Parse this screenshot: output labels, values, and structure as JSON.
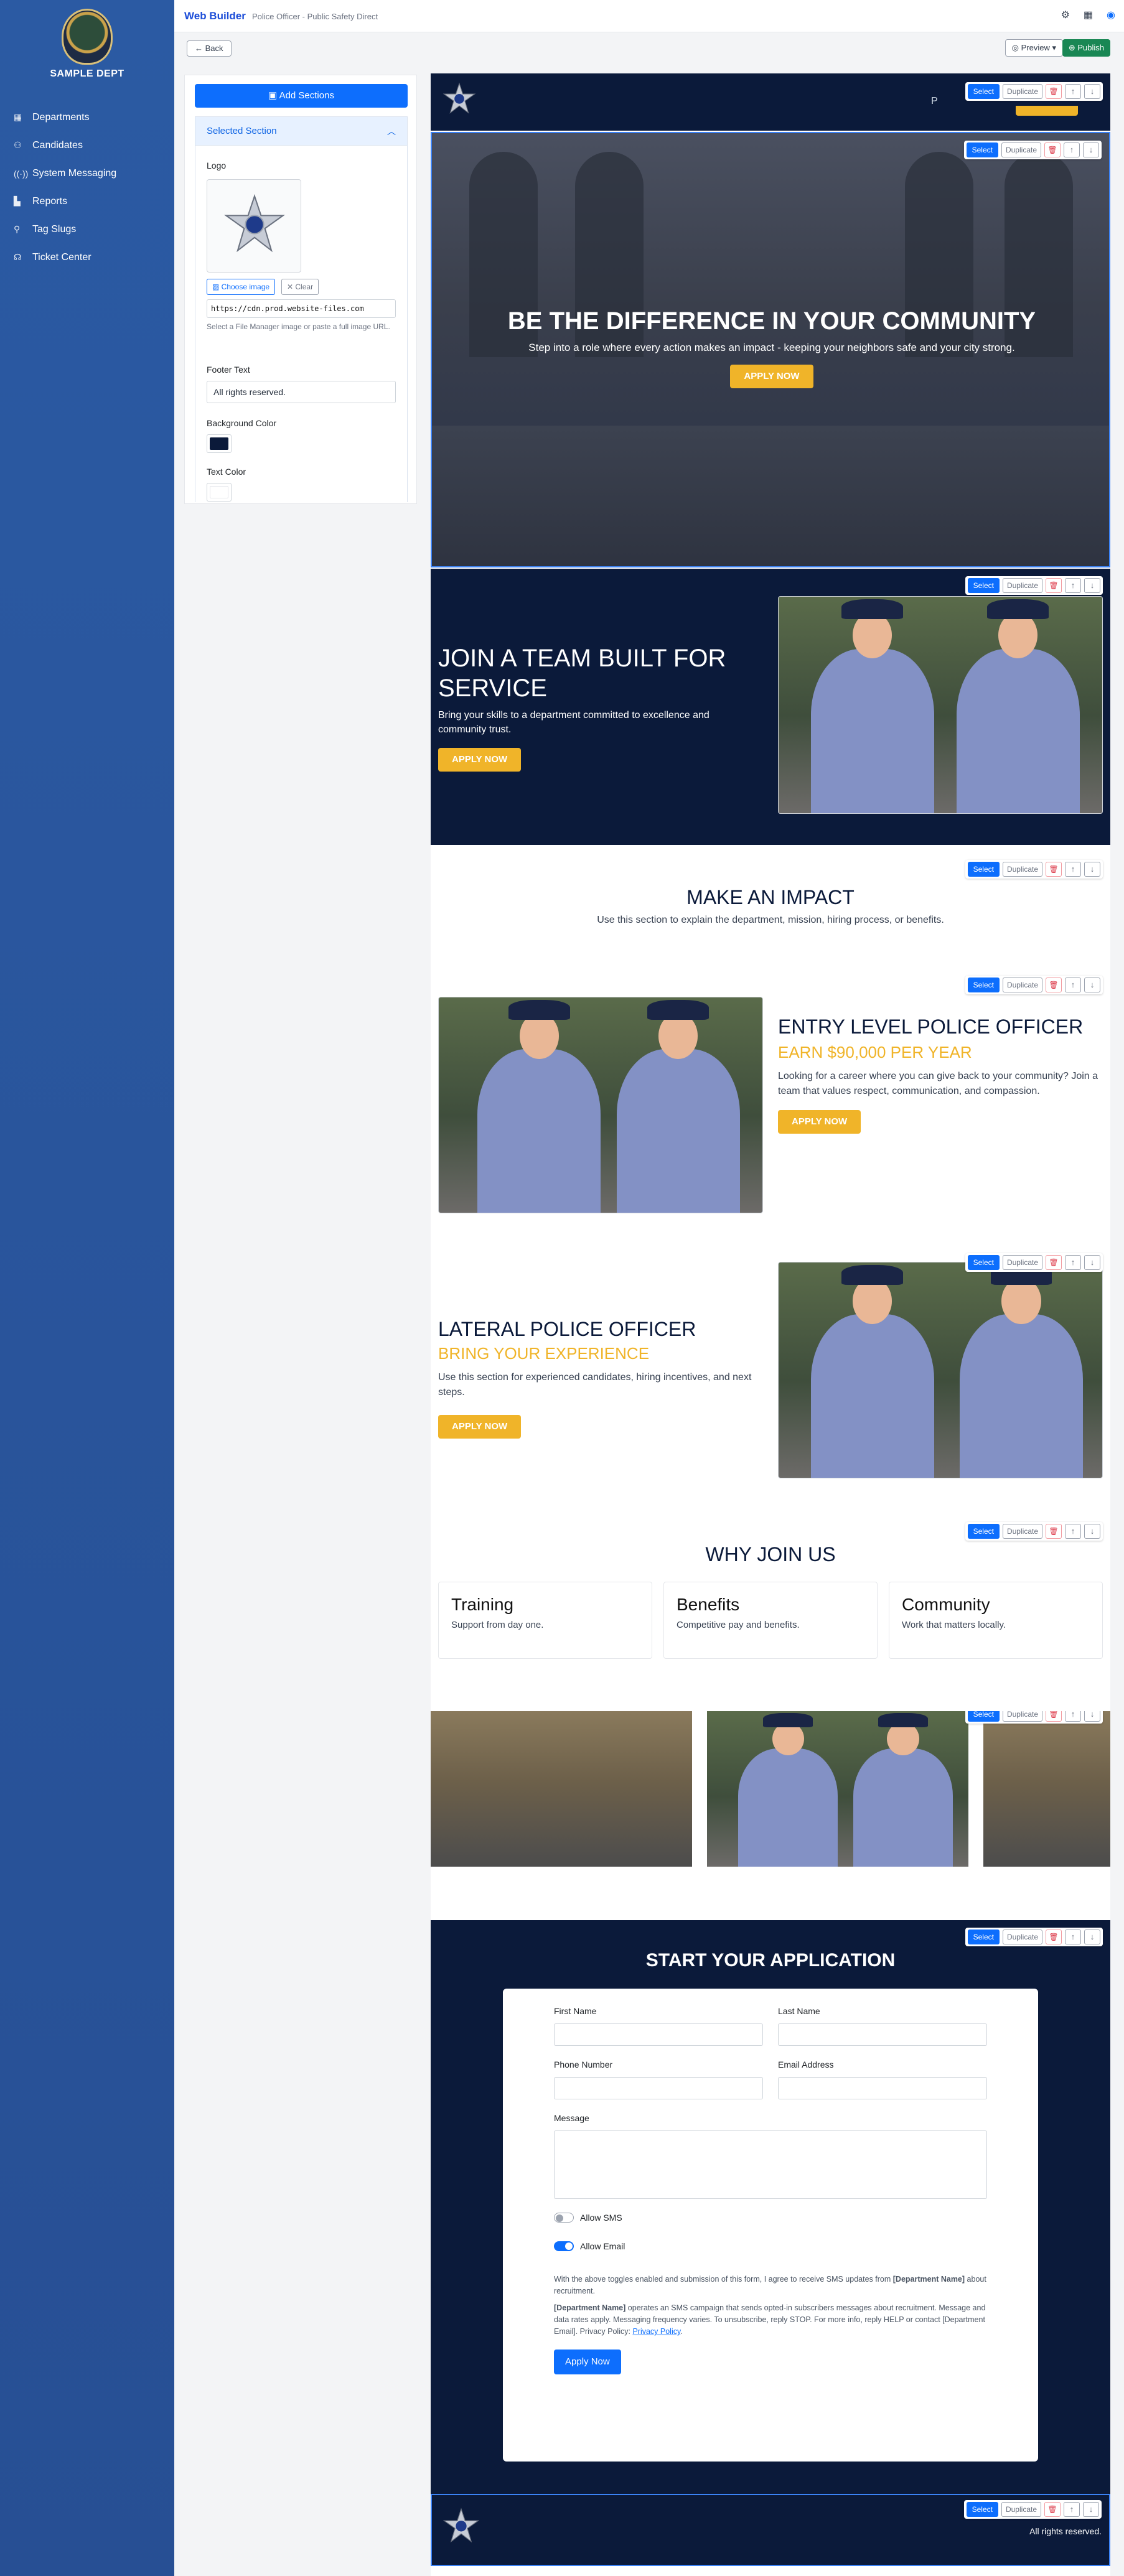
{
  "sidebar": {
    "dept_name": "SAMPLE DEPT",
    "items": [
      {
        "label": "Departments",
        "icon": "building-icon"
      },
      {
        "label": "Candidates",
        "icon": "users-icon"
      },
      {
        "label": "System Messaging",
        "icon": "broadcast-icon"
      },
      {
        "label": "Reports",
        "icon": "chart-icon"
      },
      {
        "label": "Tag Slugs",
        "icon": "tag-icon"
      },
      {
        "label": "Ticket Center",
        "icon": "headset-icon"
      }
    ]
  },
  "topbar": {
    "title": "Web Builder",
    "subtitle": "Police Officer - Public Safety Direct"
  },
  "toolbar": {
    "back_label": "Back",
    "preview_label": "Preview",
    "publish_label": "Publish"
  },
  "panel": {
    "add_sections_label": "Add Sections",
    "section_title": "Selected Section",
    "logo_label": "Logo",
    "choose_image_label": "Choose image",
    "clear_label": "Clear",
    "logo_url": "https://cdn.prod.website-files.com",
    "logo_help": "Select a File Manager image or paste a full image URL.",
    "footer_text_label": "Footer Text",
    "footer_text_value": "All rights reserved.",
    "bg_color_label": "Background Color",
    "bg_color": "#0b1a3a",
    "text_color_label": "Text Color",
    "text_color": "#ffffff"
  },
  "controls": {
    "select": "Select",
    "duplicate": "Duplicate"
  },
  "hero": {
    "title": "BE THE DIFFERENCE IN YOUR COMMUNITY",
    "subtitle": "Step into a role where every action makes an impact - keeping your neighbors safe and your city strong.",
    "cta": "APPLY NOW"
  },
  "team": {
    "title": "JOIN A TEAM BUILT FOR SERVICE",
    "text": "Bring your skills to a department committed to excellence and community trust.",
    "cta": "APPLY NOW"
  },
  "impact": {
    "title": "MAKE AN IMPACT",
    "text": "Use this section to explain the department, mission, hiring process, or benefits."
  },
  "entry": {
    "title": "ENTRY LEVEL POLICE OFFICER",
    "highlight": "EARN $90,000 PER YEAR",
    "text": "Looking for a career where you can give back to your community? Join a team that values respect, communication, and compassion.",
    "cta": "APPLY NOW"
  },
  "lateral": {
    "title": "LATERAL POLICE OFFICER",
    "highlight": "BRING YOUR EXPERIENCE",
    "text": "Use this section for experienced candidates, hiring incentives, and next steps.",
    "cta": "APPLY NOW"
  },
  "why": {
    "title": "WHY JOIN US",
    "cards": [
      {
        "title": "Training",
        "text": "Support from day one."
      },
      {
        "title": "Benefits",
        "text": "Competitive pay and benefits."
      },
      {
        "title": "Community",
        "text": "Work that matters locally."
      }
    ]
  },
  "application": {
    "title": "START YOUR APPLICATION",
    "first_name": "First Name",
    "last_name": "Last Name",
    "phone": "Phone Number",
    "email": "Email Address",
    "message": "Message",
    "allow_sms": "Allow SMS",
    "allow_email": "Allow Email",
    "consent_text": "With the above toggles enabled and submission of this form, I agree to receive SMS updates from",
    "consent_dept": "[Department Name]",
    "consent_tail": "about recruitment.",
    "sms_dept": "[Department Name]",
    "sms_text": "operates an SMS campaign that sends opted-in subscribers messages about recruitment. Message and data rates apply. Messaging frequency varies. To unsubscribe, reply STOP. For more info, reply HELP or contact [Department Email]. Privacy Policy:",
    "privacy_link": "Privacy Policy",
    "submit": "Apply Now"
  },
  "header_partial_text": "P",
  "footer": {
    "text": "All rights reserved."
  },
  "colors": {
    "navy": "#0b1a3a",
    "gold": "#f0b429",
    "primary": "#0d6efd"
  }
}
